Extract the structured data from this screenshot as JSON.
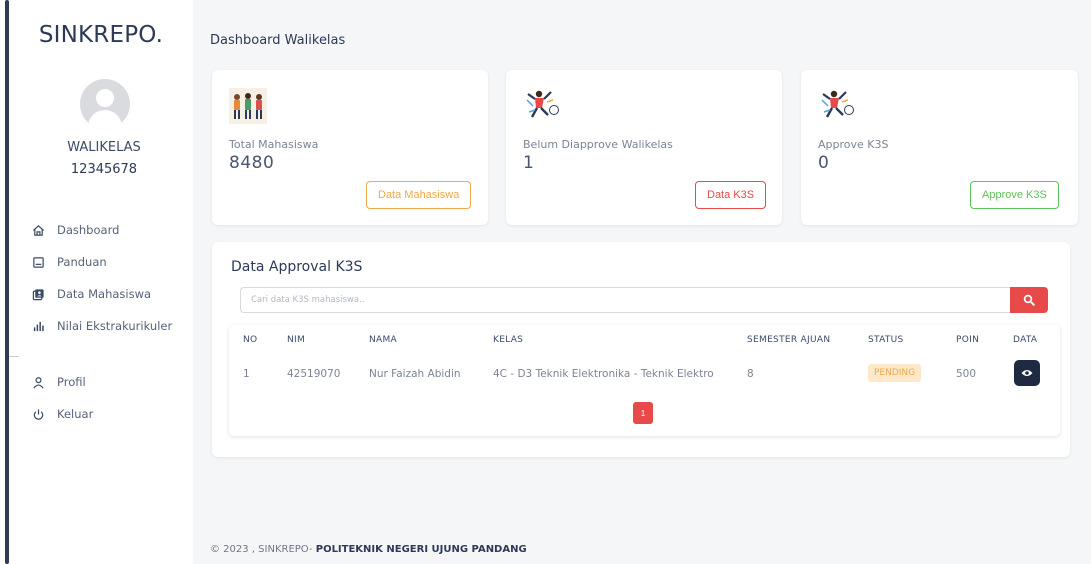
{
  "sidebar": {
    "brand": "SINKREPO.",
    "role": "WALIKELAS",
    "user_id": "12345678",
    "nav": [
      {
        "label": "Dashboard",
        "icon": "home-icon"
      },
      {
        "label": "Panduan",
        "icon": "book-icon"
      },
      {
        "label": "Data Mahasiswa",
        "icon": "collection-icon"
      },
      {
        "label": "Nilai Ekstrakurikuler",
        "icon": "bar-chart-icon"
      }
    ],
    "nav2": [
      {
        "label": "Profil",
        "icon": "user-icon"
      },
      {
        "label": "Keluar",
        "icon": "power-icon"
      }
    ]
  },
  "header": {
    "title": "Dashboard Walikelas"
  },
  "stats": [
    {
      "label": "Total Mahasiswa",
      "value": "8480",
      "button": "Data Mahasiswa",
      "button_color": "#f0a94b"
    },
    {
      "label": "Belum Diapprove Walikelas",
      "value": "1",
      "button": "Data K3S",
      "button_color": "#e84949"
    },
    {
      "label": "Approve K3S",
      "value": "0",
      "button": "Approve K3S",
      "button_color": "#5cc45c"
    }
  ],
  "approval": {
    "title": "Data Approval K3S",
    "search_placeholder": "Cari data K3S mahasiswa..",
    "columns": {
      "no": "NO",
      "nim": "NIM",
      "nama": "NAMA",
      "kelas": "KELAS",
      "semester": "SEMESTER AJUAN",
      "status": "STATUS",
      "poin": "POIN",
      "data": "DATA"
    },
    "rows": [
      {
        "no": "1",
        "nim": "42519070",
        "nama": "Nur Faizah Abidin",
        "kelas": "4C - D3 Teknik Elektronika - Teknik Elektro",
        "semester": "8",
        "status": "PENDING",
        "poin": "500"
      }
    ],
    "current_page": "1"
  },
  "footer": {
    "prefix": "© 2023 , SINKREPO- ",
    "org": "POLITEKNIK NEGERI UJUNG PANDANG"
  },
  "colors": {
    "accent": "#e84949",
    "navy": "#1e2a42",
    "warning": "#f0a94b",
    "success": "#5cc45c"
  }
}
